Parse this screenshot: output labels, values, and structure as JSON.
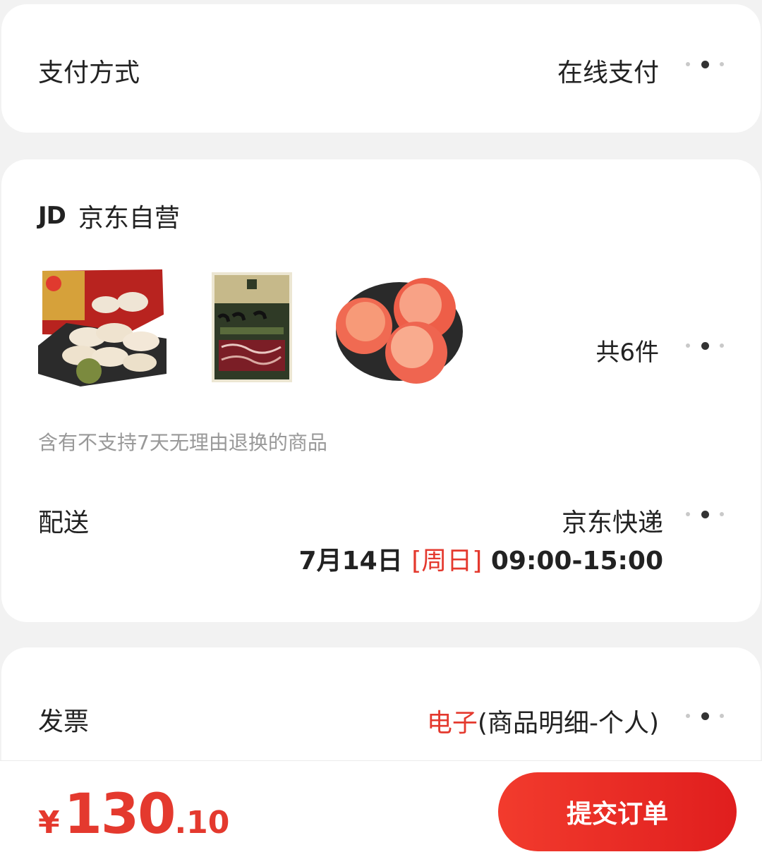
{
  "payment": {
    "label": "支付方式",
    "value": "在线支付"
  },
  "shop": {
    "logo": "JD",
    "name": "京东自营",
    "items": [
      {
        "icon": "dumplings-product-image"
      },
      {
        "icon": "beef-steak-product-image"
      },
      {
        "icon": "peaches-product-image"
      }
    ],
    "count": "共6件",
    "notice": "含有不支持7天无理由退换的商品",
    "delivery": {
      "label": "配送",
      "value": "京东快递",
      "date": "7月14日",
      "weekday": "[周日]",
      "time": "09:00-15:00"
    }
  },
  "invoice": {
    "label": "发票",
    "type": "电子",
    "detail": "(商品明细-个人)"
  },
  "footer": {
    "currency": "¥",
    "price_int": "130",
    "price_dec": ".10",
    "submit": "提交订单"
  },
  "colors": {
    "accent": "#e4392e",
    "background": "#f2f2f2"
  }
}
